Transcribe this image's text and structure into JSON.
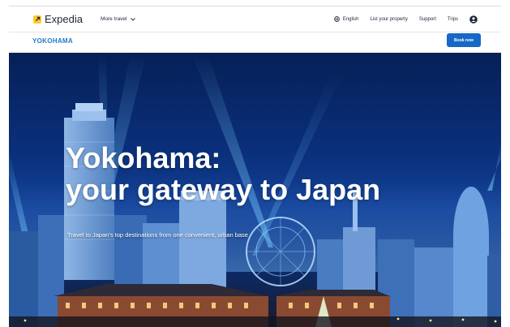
{
  "header": {
    "logo_text": "Expedia",
    "more_travel_label": "More travel",
    "language_label": "English",
    "list_property_label": "List your property",
    "support_label": "Support",
    "trips_label": "Trips"
  },
  "subheader": {
    "title": "YOKOHAMA",
    "book_now_label": "Book now"
  },
  "hero": {
    "title_line1": "Yokohama:",
    "title_line2": "your gateway to Japan",
    "subtitle": "Travel to Japan's top destinations from one convenient, urban base"
  },
  "colors": {
    "brand_yellow": "#ffc72c",
    "brand_blue": "#1f78c8",
    "button_blue": "#1668c6",
    "text_dark": "#1e243a"
  },
  "icons": {
    "logo": "arrow-up-right-icon",
    "more_travel": "chevron-down-icon",
    "language": "globe-icon",
    "account": "user-circle-icon"
  }
}
